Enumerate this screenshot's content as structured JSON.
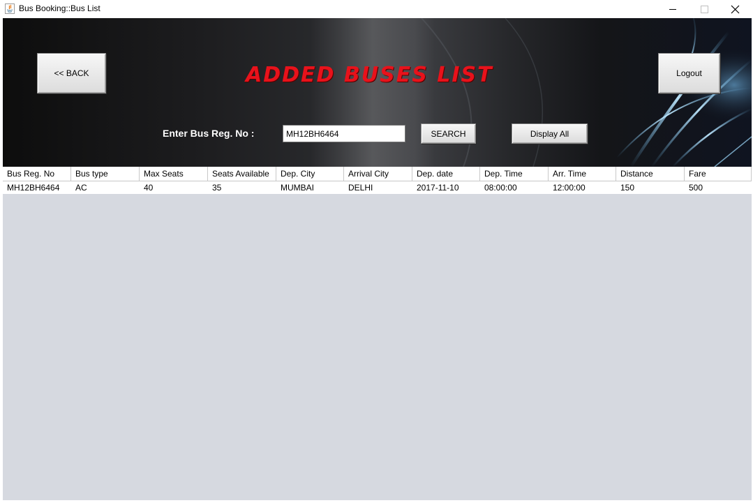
{
  "window": {
    "title": "Bus Booking::Bus List"
  },
  "header": {
    "back_label": "<< BACK",
    "page_title": "ADDED BUSES LIST",
    "logout_label": "Logout"
  },
  "search": {
    "label": "Enter Bus Reg. No :",
    "value": "MH12BH6464",
    "search_label": "SEARCH",
    "display_all_label": "Display All"
  },
  "table": {
    "columns": [
      "Bus Reg. No",
      "Bus type",
      "Max Seats",
      "Seats Available",
      "Dep. City",
      "Arrival City",
      "Dep. date",
      "Dep. Time",
      "Arr. Time",
      "Distance",
      "Fare"
    ],
    "rows": [
      [
        "MH12BH6464",
        "AC",
        "40",
        "35",
        "MUMBAI",
        "DELHI",
        "2017-11-10",
        "08:00:00",
        "12:00:00",
        "150",
        "500"
      ]
    ]
  },
  "colors": {
    "title_red": "#e8121b",
    "table_bg": "#d6d9e0",
    "banner_dark": "#1c1c1e",
    "accent_blue": "#6fc6ff"
  }
}
